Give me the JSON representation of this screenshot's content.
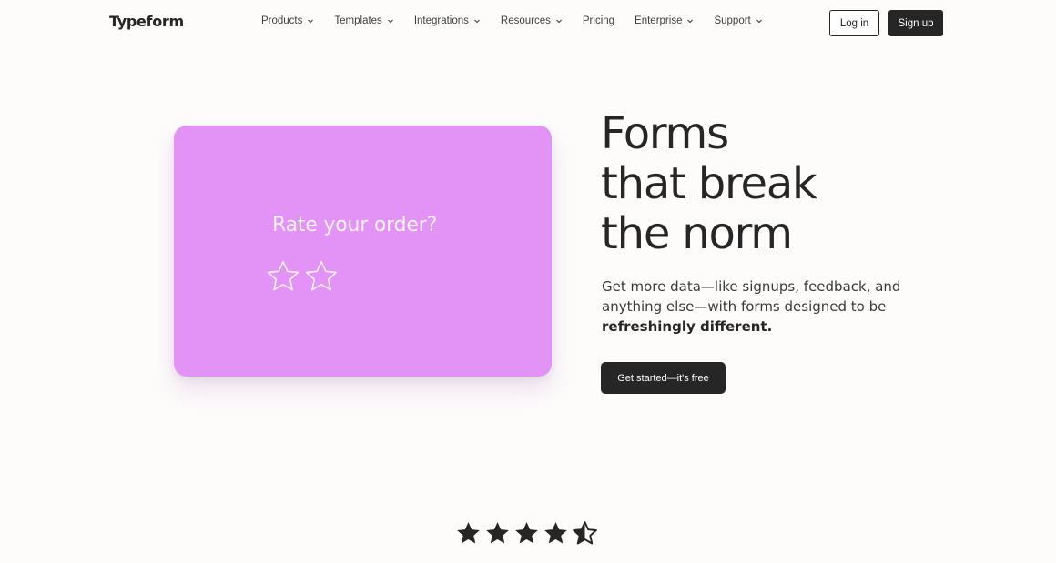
{
  "header": {
    "logo": "Typeform",
    "nav": [
      {
        "label": "Products",
        "dropdown": true
      },
      {
        "label": "Templates",
        "dropdown": true
      },
      {
        "label": "Integrations",
        "dropdown": true
      },
      {
        "label": "Resources",
        "dropdown": true
      },
      {
        "label": "Pricing",
        "dropdown": false
      },
      {
        "label": "Enterprise",
        "dropdown": true
      },
      {
        "label": "Support",
        "dropdown": true
      }
    ],
    "login_label": "Log in",
    "signup_label": "Sign up"
  },
  "card": {
    "question": "Rate your order?",
    "stars_shown": 2,
    "background": "#e293f5"
  },
  "hero": {
    "headline": [
      "Forms",
      "that break",
      "the norm"
    ],
    "description_lines": [
      "Get more data—like signups, feedback, and",
      "anything else—with forms designed to be"
    ],
    "description_bold": "refreshingly different.",
    "cta_label": "Get started—it's free"
  },
  "rating": {
    "value": 4.5,
    "max": 5
  },
  "colors": {
    "dark": "#262627",
    "card": "#e293f5",
    "background": "#fdfcfb"
  }
}
